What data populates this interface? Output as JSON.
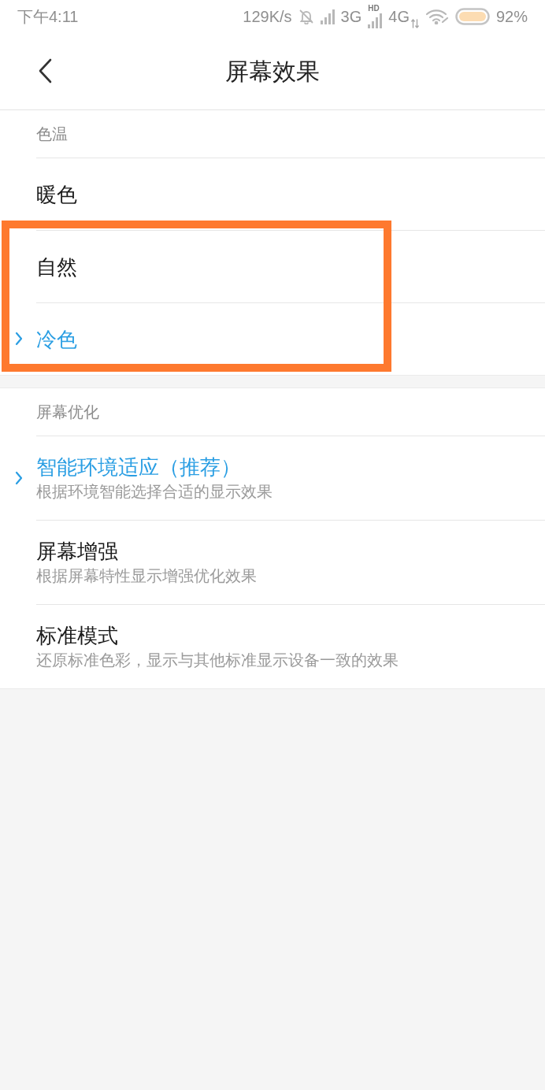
{
  "status_bar": {
    "time": "下午4:11",
    "speed": "129K/s",
    "network_3g": "3G",
    "hd_label": "HD",
    "network_4g": "4G",
    "battery": "92%"
  },
  "header": {
    "title": "屏幕效果"
  },
  "sections": [
    {
      "title": "色温",
      "items": [
        {
          "label": "暖色",
          "selected": false
        },
        {
          "label": "自然",
          "selected": false
        },
        {
          "label": "冷色",
          "selected": true
        }
      ]
    },
    {
      "title": "屏幕优化",
      "items": [
        {
          "label": "智能环境适应（推荐）",
          "description": "根据环境智能选择合适的显示效果",
          "selected": true
        },
        {
          "label": "屏幕增强",
          "description": "根据屏幕特性显示增强优化效果",
          "selected": false
        },
        {
          "label": "标准模式",
          "description": "还原标准色彩，显示与其他标准显示设备一致的效果",
          "selected": false
        }
      ]
    }
  ]
}
